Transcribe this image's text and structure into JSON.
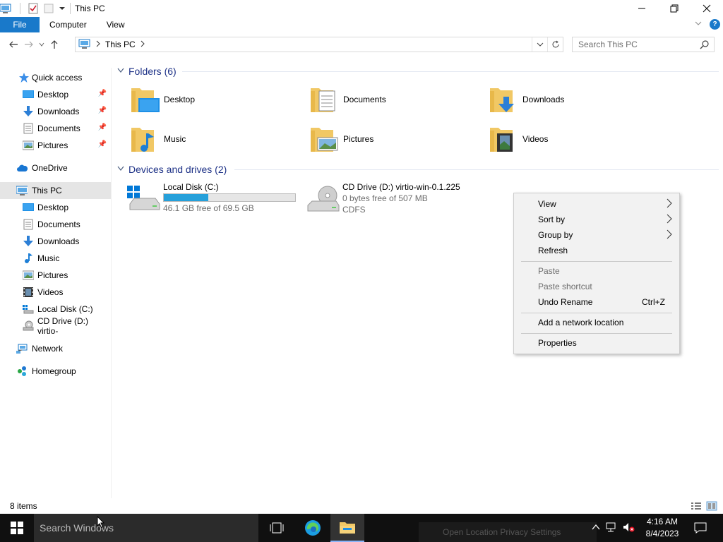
{
  "window": {
    "title": "This PC",
    "controls": {
      "minimize": "—",
      "maximize": "❐",
      "close": "✕"
    }
  },
  "ribbon": {
    "tabs": [
      "File",
      "Computer",
      "View"
    ],
    "help": "?"
  },
  "address": {
    "crumbs": [
      "This PC"
    ],
    "search_placeholder": "Search This PC"
  },
  "sidebar": {
    "items": [
      {
        "label": "Quick access",
        "icon": "star-icon",
        "pinned": false
      },
      {
        "label": "Desktop",
        "icon": "desktop-icon",
        "pinned": true
      },
      {
        "label": "Downloads",
        "icon": "downloads-icon",
        "pinned": true
      },
      {
        "label": "Documents",
        "icon": "documents-icon",
        "pinned": true
      },
      {
        "label": "Pictures",
        "icon": "pictures-icon",
        "pinned": true
      },
      {
        "label": "OneDrive",
        "icon": "cloud-icon",
        "pinned": false
      },
      {
        "label": "This PC",
        "icon": "computer-icon",
        "pinned": false,
        "selected": true
      },
      {
        "label": "Desktop",
        "icon": "desktop-icon",
        "pinned": false
      },
      {
        "label": "Documents",
        "icon": "documents-icon",
        "pinned": false
      },
      {
        "label": "Downloads",
        "icon": "downloads-icon",
        "pinned": false
      },
      {
        "label": "Music",
        "icon": "music-icon",
        "pinned": false
      },
      {
        "label": "Pictures",
        "icon": "pictures-icon",
        "pinned": false
      },
      {
        "label": "Videos",
        "icon": "videos-icon",
        "pinned": false
      },
      {
        "label": "Local Disk (C:)",
        "icon": "drive-icon",
        "pinned": false
      },
      {
        "label": "CD Drive (D:) virtio-",
        "icon": "cd-drive-icon",
        "pinned": false
      },
      {
        "label": "Network",
        "icon": "network-icon",
        "pinned": false
      },
      {
        "label": "Homegroup",
        "icon": "homegroup-icon",
        "pinned": false
      }
    ]
  },
  "content": {
    "folders_header": "Folders (6)",
    "folders": [
      {
        "label": "Desktop",
        "icon": "desktop-folder-icon"
      },
      {
        "label": "Documents",
        "icon": "documents-folder-icon"
      },
      {
        "label": "Downloads",
        "icon": "downloads-folder-icon"
      },
      {
        "label": "Music",
        "icon": "music-folder-icon"
      },
      {
        "label": "Pictures",
        "icon": "pictures-folder-icon"
      },
      {
        "label": "Videos",
        "icon": "videos-folder-icon"
      }
    ],
    "devices_header": "Devices and drives (2)",
    "drives": [
      {
        "label": "Local Disk (C:)",
        "sub": "46.1 GB free of 69.5 GB",
        "used_fraction": 0.337
      },
      {
        "label": "CD Drive (D:) virtio-win-0.1.225",
        "sub": "0 bytes free of 507 MB",
        "sub2": "CDFS"
      }
    ]
  },
  "status": {
    "items": "8 items"
  },
  "context_menu": {
    "items": [
      {
        "label": "View",
        "submenu": true,
        "disabled": false
      },
      {
        "label": "Sort by",
        "submenu": true,
        "disabled": false
      },
      {
        "label": "Group by",
        "submenu": true,
        "disabled": false
      },
      {
        "label": "Refresh",
        "submenu": false,
        "disabled": false
      },
      {
        "label": "Paste",
        "submenu": false,
        "disabled": true
      },
      {
        "label": "Paste shortcut",
        "submenu": false,
        "disabled": true
      },
      {
        "label": "Undo Rename",
        "shortcut": "Ctrl+Z",
        "submenu": false,
        "disabled": false
      },
      {
        "label": "Add a network location",
        "submenu": false,
        "disabled": false
      },
      {
        "label": "Properties",
        "submenu": false,
        "disabled": false
      }
    ]
  },
  "taskbar": {
    "search_placeholder": "Search Windows",
    "toast": "Open Location Privacy Settings",
    "time": "4:16 AM",
    "date": "8/4/2023"
  },
  "colors": {
    "accent": "#1979ca",
    "group_header": "#1e3287",
    "drive_fill": "#26a0da",
    "taskbar": "#101010"
  }
}
